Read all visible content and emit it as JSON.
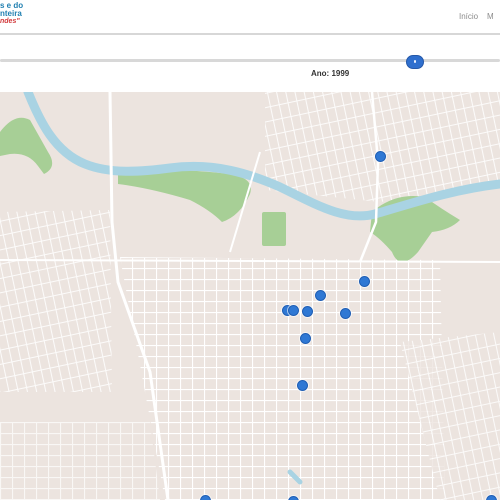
{
  "header": {
    "brand_line1": "s e do",
    "brand_line2": "nteira",
    "brand_line3": "ndes\"",
    "nav_inicio": "Início",
    "nav_more": "M"
  },
  "slider": {
    "label": "Ano: 1999",
    "value_label": "1999"
  },
  "map": {
    "marker_color": "#2f78d4",
    "water_color": "#a9d3e3",
    "park_color": "#9fcb8f",
    "land_color": "#ece4df",
    "road_color": "#ffffff",
    "marker_count": 12
  }
}
